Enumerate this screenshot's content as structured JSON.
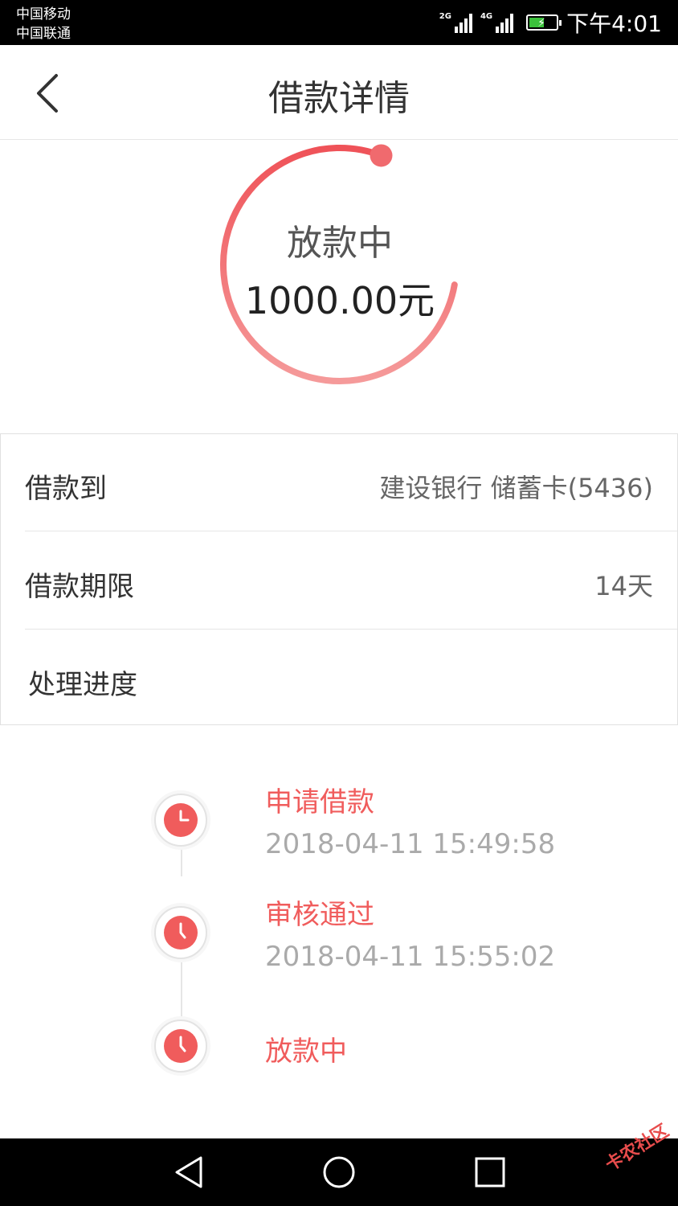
{
  "status_bar": {
    "carrier_1": "中国移动",
    "carrier_2": "中国联通",
    "network_1": "2G",
    "network_2": "4G",
    "time": "下午4:01"
  },
  "header": {
    "title": "借款详情",
    "back_icon": "chevron-left-icon"
  },
  "ring": {
    "status": "放款中",
    "amount": "1000.00元",
    "progress_fraction": 0.78,
    "accent_color": "#f05c5c"
  },
  "details": {
    "rows": [
      {
        "label": "借款到",
        "value": "建设银行 储蓄卡(5436)"
      },
      {
        "label": "借款期限",
        "value": "14天"
      },
      {
        "label": "处理进度",
        "value": ""
      }
    ]
  },
  "timeline": [
    {
      "label": "申请借款",
      "time": "2018-04-11 15:49:58",
      "icon": "clock-icon"
    },
    {
      "label": "审核通过",
      "time": "2018-04-11 15:55:02",
      "icon": "clock-icon"
    },
    {
      "label": "放款中",
      "time": "",
      "icon": "clock-icon"
    }
  ],
  "nav_bar": {
    "back": "triangle-back-icon",
    "home": "circle-home-icon",
    "recent": "square-recent-icon"
  },
  "watermark": "卡农社区"
}
